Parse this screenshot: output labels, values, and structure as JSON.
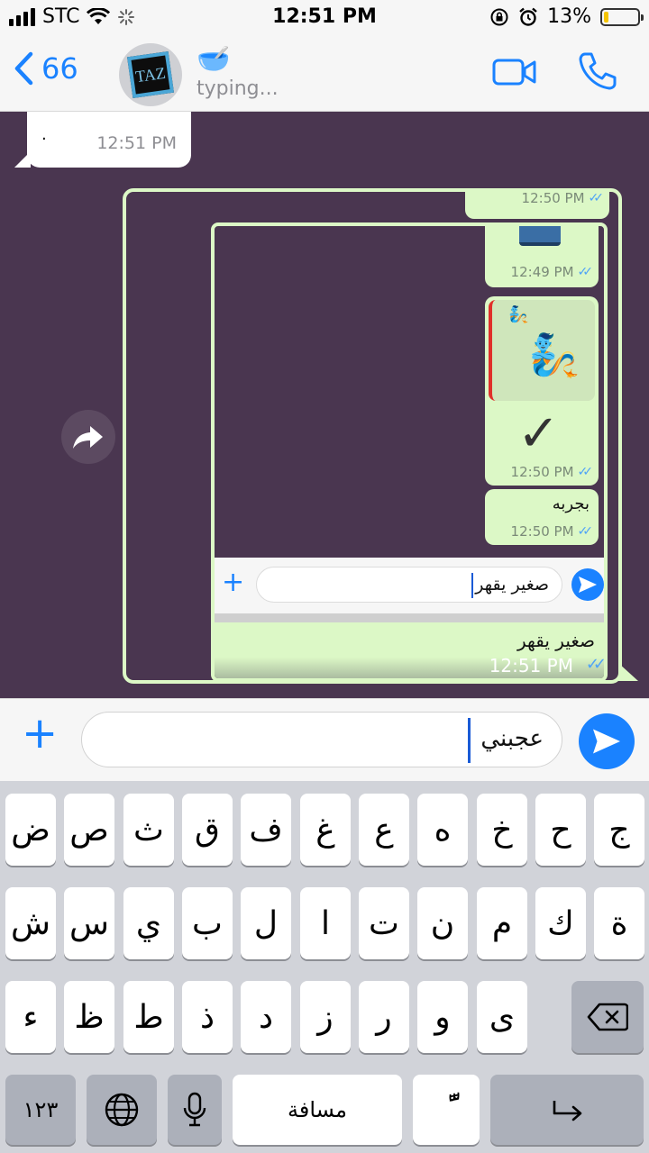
{
  "status": {
    "carrier": "STC",
    "time": "12:51 PM",
    "battery": "13%",
    "battery_level": 0.13
  },
  "header": {
    "back_count": "66",
    "avatar_text": "TAZ",
    "name_emoji": "🥣",
    "typing": "typing..."
  },
  "chat": {
    "incoming": {
      "text": "·",
      "time": "12:51 PM"
    },
    "outer_top_time": "12:50 PM",
    "book_time": "12:49 PM",
    "genie_time": "12:50 PM",
    "msg_text": "بجربه",
    "msg_time": "12:50 PM",
    "inner_input_text": "صغير يقهر",
    "inner_last_text": "صغير يقهر",
    "inner_last_time": "12:51 PM"
  },
  "input": {
    "text": "عجبني"
  },
  "keyboard": {
    "row1": [
      "ض",
      "ص",
      "ث",
      "ق",
      "ف",
      "غ",
      "ع",
      "ه",
      "خ",
      "ح",
      "ج"
    ],
    "row2": [
      "ش",
      "س",
      "ي",
      "ب",
      "ل",
      "ا",
      "ت",
      "ن",
      "م",
      "ك",
      "ة"
    ],
    "row3": [
      "ء",
      "ظ",
      "ط",
      "ذ",
      "د",
      "ز",
      "ر",
      "و",
      "ى"
    ],
    "numbers": "١٢٣",
    "space": "مسافة",
    "diacritic": "ًّ"
  }
}
